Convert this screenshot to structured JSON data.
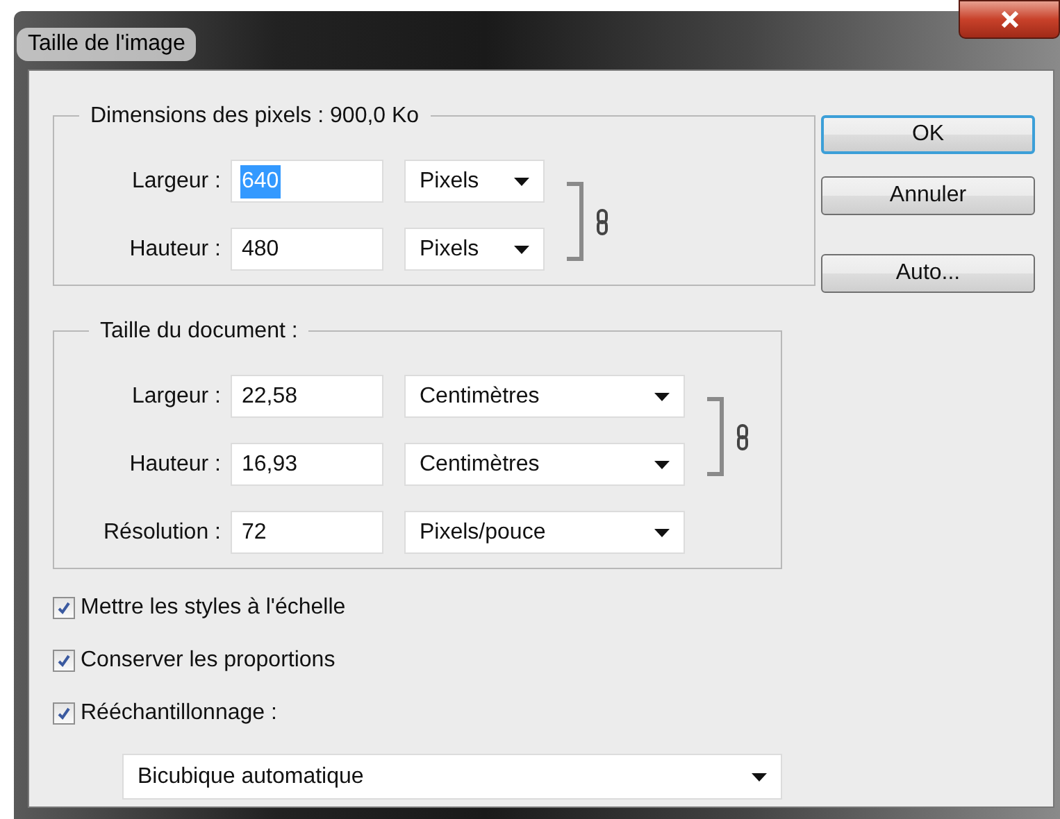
{
  "window": {
    "title": "Taille de l'image"
  },
  "pixel_dimensions": {
    "legend": "Dimensions des pixels : 900,0 Ko",
    "rows": [
      {
        "label": "Largeur :",
        "value": "640",
        "selected": true,
        "unit": "Pixels"
      },
      {
        "label": "Hauteur :",
        "value": "480",
        "selected": false,
        "unit": "Pixels"
      }
    ],
    "linked": true
  },
  "document_size": {
    "legend": "Taille du document :",
    "rows": [
      {
        "label": "Largeur :",
        "value": "22,58",
        "selected": false,
        "unit": "Centimètres"
      },
      {
        "label": "Hauteur :",
        "value": "16,93",
        "selected": false,
        "unit": "Centimètres"
      },
      {
        "label": "Résolution :",
        "value": "72",
        "selected": false,
        "unit": "Pixels/pouce"
      }
    ],
    "linked": true
  },
  "options": [
    {
      "label": "Mettre les styles à l'échelle",
      "checked": true
    },
    {
      "label": "Conserver les proportions",
      "checked": true
    },
    {
      "label": "Rééchantillonnage :",
      "checked": true
    }
  ],
  "resample_method": "Bicubique automatique",
  "buttons": [
    {
      "label": "OK",
      "default": true
    },
    {
      "label": "Annuler",
      "default": false
    },
    {
      "label": "Auto...",
      "default": false
    }
  ]
}
